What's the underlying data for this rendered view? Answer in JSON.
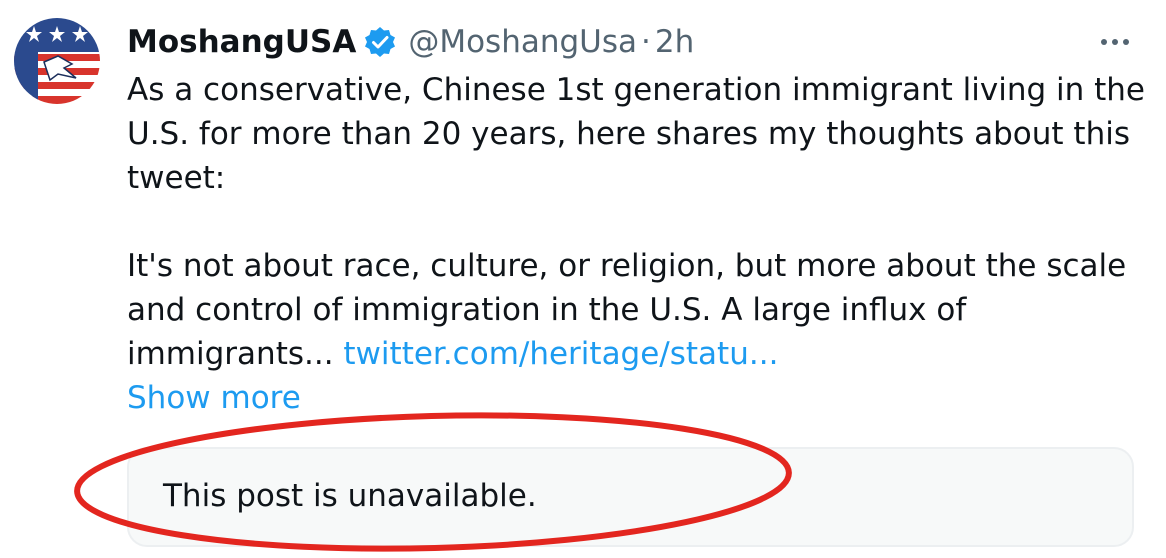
{
  "tweet": {
    "display_name": "MoshangUSA",
    "handle": "@MoshangUsa",
    "separator": "·",
    "time": "2h",
    "verified_icon": "verified-badge-icon",
    "more_icon": "more-options-icon",
    "text_lines": [
      "As a conservative, Chinese 1st generation immigrant living in the",
      "U.S.  for more than 20 years, here shares my thoughts about this",
      "tweet:",
      "It's not about race, culture, or religion, but more about the scale",
      "and control of immigration in the U.S. A large influx of",
      "immigrants..."
    ],
    "link_text": "twitter.com/heritage/statu...",
    "show_more": "Show more",
    "quoted_post_status": "This post is unavailable."
  },
  "colors": {
    "link": "#1d9bf0",
    "muted": "#536471",
    "text": "#0f1419",
    "annotation": "#e3261f",
    "card_bg": "#f7f9f9"
  }
}
